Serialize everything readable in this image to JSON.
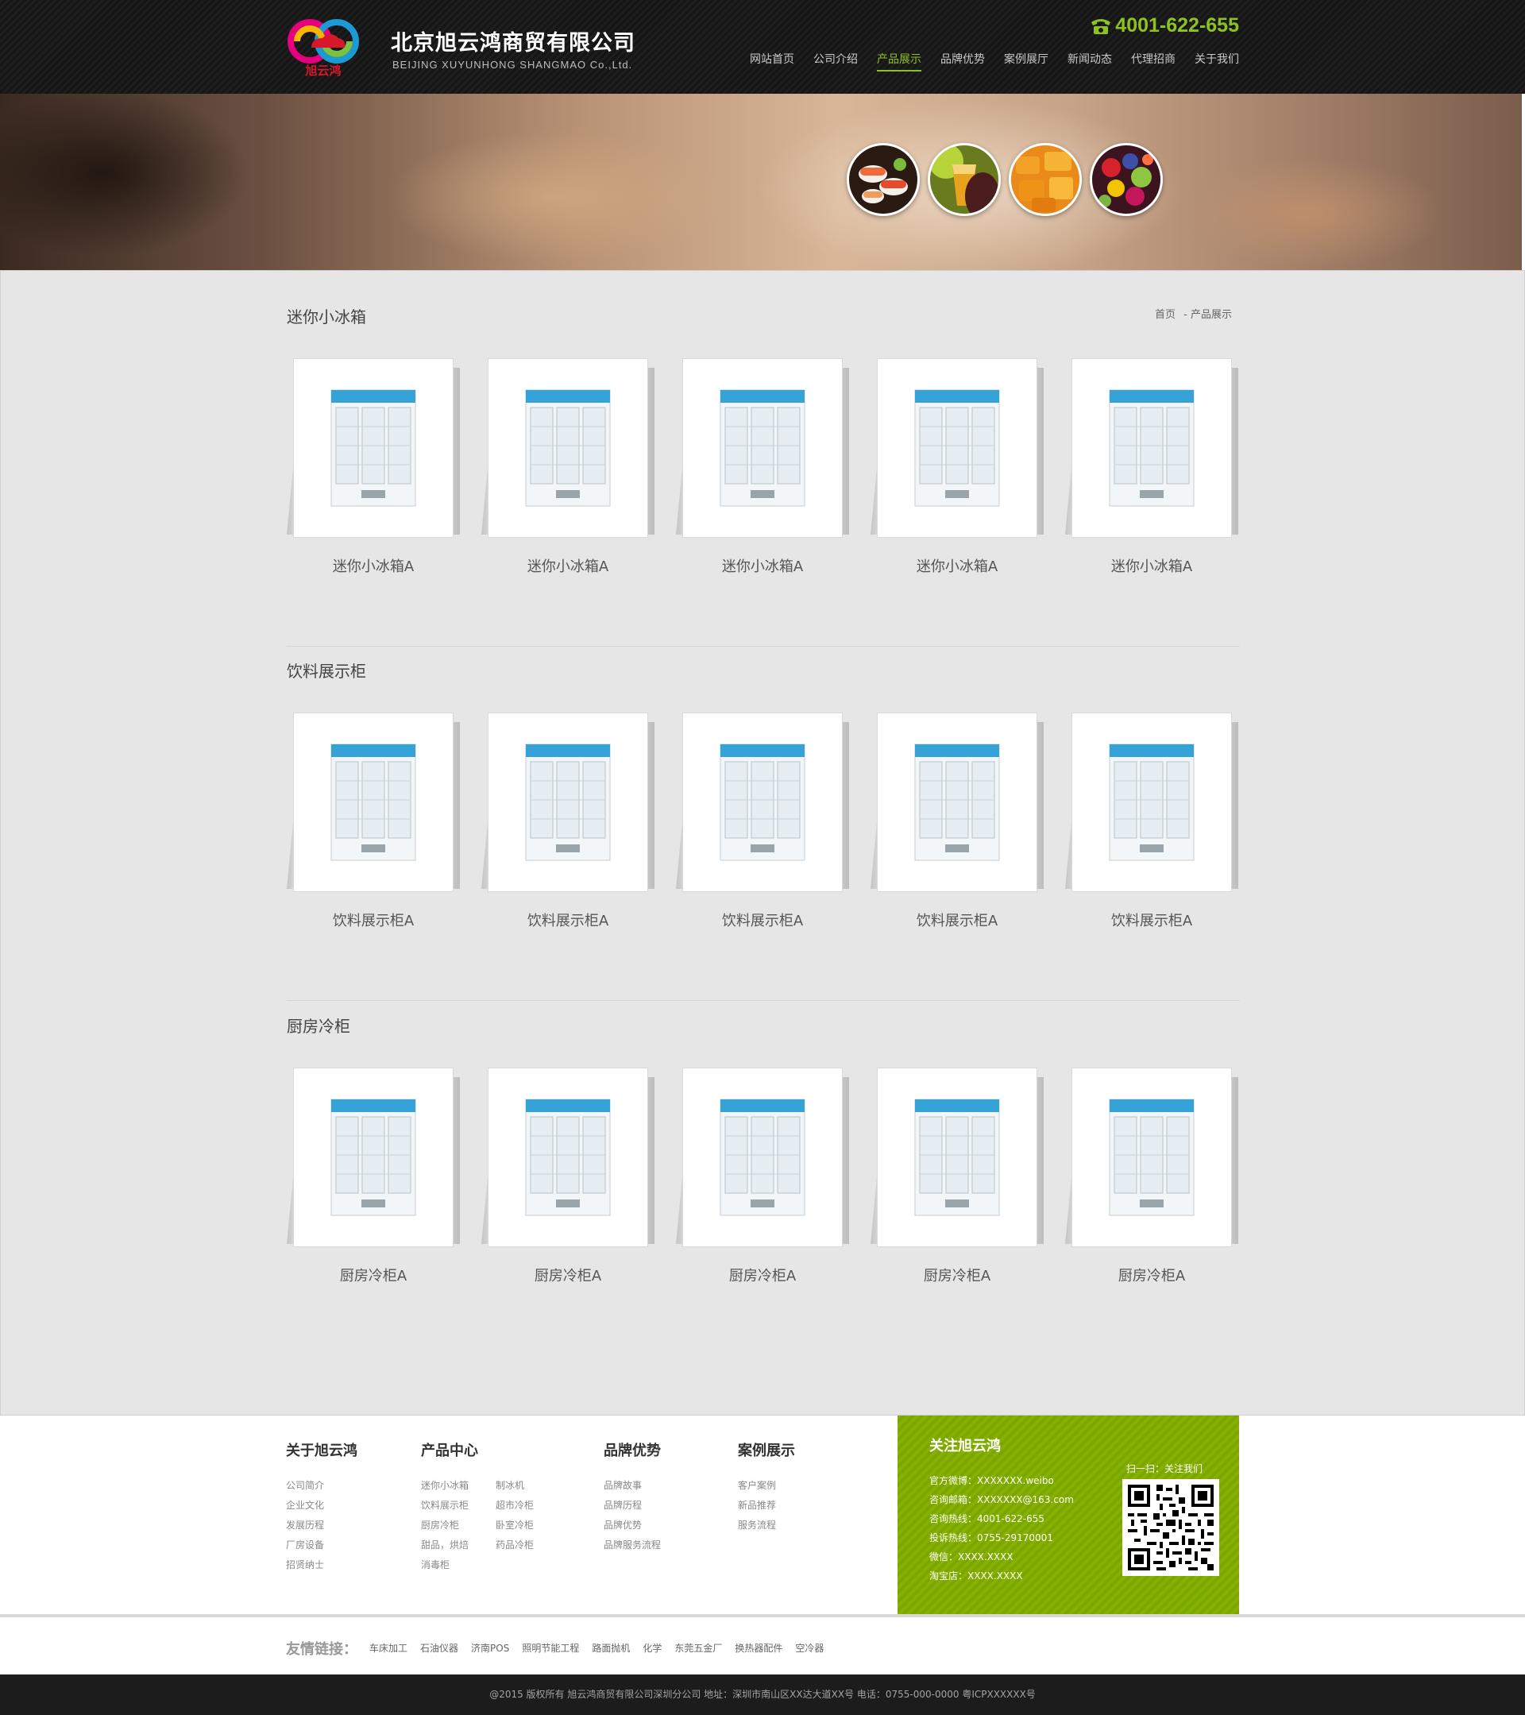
{
  "header": {
    "company_cn": "北京旭云鸿商贸有限公司",
    "company_en": "BEIJING XUYUNHONG SHANGMAO Co.,Ltd.",
    "logo_text": "旭云鸿",
    "phone": "4001-622-655",
    "nav": [
      {
        "label": "网站首页",
        "active": false
      },
      {
        "label": "公司介绍",
        "active": false
      },
      {
        "label": "产品展示",
        "active": true
      },
      {
        "label": "品牌优势",
        "active": false
      },
      {
        "label": "案例展厅",
        "active": false
      },
      {
        "label": "新闻动态",
        "active": false
      },
      {
        "label": "代理招商",
        "active": false
      },
      {
        "label": "关于我们",
        "active": false
      }
    ]
  },
  "banner": {
    "circles": [
      "sushi-icon",
      "juice-icon",
      "candy-icon",
      "fruits-icon"
    ]
  },
  "breadcrumb": {
    "home": "首页",
    "current": "- 产品展示"
  },
  "sections": [
    {
      "title": "迷你小冰箱",
      "items": [
        "迷你小冰箱A",
        "迷你小冰箱A",
        "迷你小冰箱A",
        "迷你小冰箱A",
        "迷你小冰箱A"
      ]
    },
    {
      "title": "饮料展示柜",
      "items": [
        "饮料展示柜A",
        "饮料展示柜A",
        "饮料展示柜A",
        "饮料展示柜A",
        "饮料展示柜A"
      ]
    },
    {
      "title": "厨房冷柜",
      "items": [
        "厨房冷柜A",
        "厨房冷柜A",
        "厨房冷柜A",
        "厨房冷柜A",
        "厨房冷柜A"
      ]
    }
  ],
  "footer": {
    "about": {
      "title": "关于旭云鸿",
      "links": [
        "公司简介",
        "企业文化",
        "发展历程",
        "厂房设备",
        "招贤纳士"
      ]
    },
    "products": {
      "title": "产品中心",
      "links_col1": [
        "迷你小冰箱",
        "饮料展示柜",
        "厨房冷柜",
        "甜品，烘焙",
        "消毒柜"
      ],
      "links_col2": [
        "制冰机",
        "超市冷柜",
        "卧室冷柜",
        "药品冷柜"
      ]
    },
    "brand": {
      "title": "品牌优势",
      "links": [
        "品牌故事",
        "品牌历程",
        "品牌优势",
        "品牌服务流程"
      ]
    },
    "cases": {
      "title": "案例展示",
      "links": [
        "客户案例",
        "新品推荐",
        "服务流程"
      ]
    },
    "follow": {
      "title": "关注旭云鸿",
      "scan": "扫一扫：关注我们",
      "info": [
        "官方微博：XXXXXXX.weibo",
        "咨询邮箱：XXXXXXX@163.com",
        "咨询热线：4001-622-655",
        "投诉热线：0755-29170001",
        "微信：XXXX.XXXX",
        "淘宝店：XXXX.XXXX"
      ]
    }
  },
  "friend_links": {
    "title": "友情链接：",
    "links": [
      "车床加工",
      "石油仪器",
      "济南POS",
      "照明节能工程",
      "路面抛机",
      "化学",
      "东莞五金厂",
      "换热器配件",
      "空冷器"
    ]
  },
  "copyright": "@2015 版权所有 旭云鸿商贸有限公司深圳分公司 地址：深圳市南山区XX达大道XX号 电话：0755-000-0000 粤ICPXXXXXX号",
  "colors": {
    "accent": "#8ec21f",
    "header_bg": "#1a1a1a",
    "main_bg": "#e6e6e6",
    "follow_bg": "#82ad00"
  }
}
